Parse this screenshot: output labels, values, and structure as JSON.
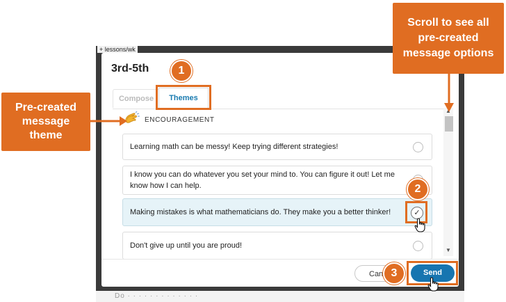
{
  "background": {
    "breadcrumb": "+ lessons/wk",
    "bottom_text": "Do  ·  ·  ·  ·  ·  ·  ·  ·  ·  ·  ·  ·  ·"
  },
  "dialog": {
    "title": "3rd-5th",
    "tabs": [
      {
        "label": "Compose",
        "active": false
      },
      {
        "label": "Themes",
        "active": true
      }
    ],
    "theme": {
      "icon": "clapping-hands-icon",
      "label": "ENCOURAGEMENT"
    },
    "messages": [
      {
        "text": "Learning math can be messy! Keep trying different strategies!",
        "selected": false
      },
      {
        "text": "I know you can do whatever you set your mind to. You can figure it out! Let me know how I can help.",
        "selected": false
      },
      {
        "text": "Making mistakes is what mathematicians do. They make you a better thinker!",
        "selected": true
      },
      {
        "text": "Don't give up until you are proud!",
        "selected": false
      }
    ],
    "buttons": {
      "cancel": "Cancel",
      "send": "Send"
    }
  },
  "callouts": {
    "left_text": "Pre-created message theme",
    "right_text": "Scroll to see all pre-created message options",
    "step1": "1",
    "step2": "2",
    "step3": "3"
  },
  "colors": {
    "accent": "#e06d22",
    "primary": "#1775b0",
    "selected_row": "#e6f3f8"
  }
}
